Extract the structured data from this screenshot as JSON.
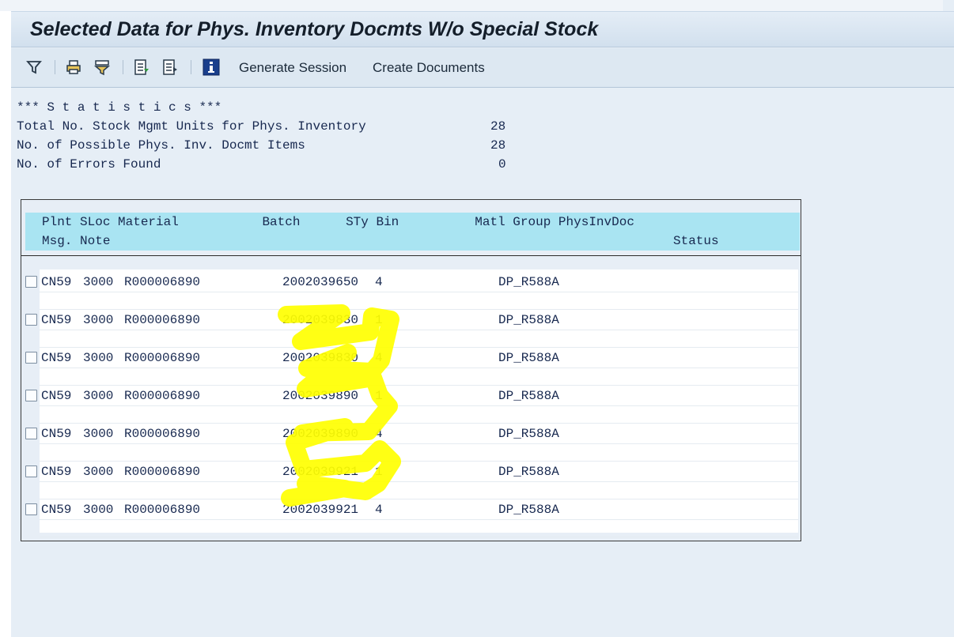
{
  "window": {
    "title": "Selected Data for Phys. Inventory Docmts W/o Special Stock"
  },
  "toolbar": {
    "icons": [
      "filter-icon",
      "print-icon",
      "print-filter-icon",
      "export-icon",
      "export-local-icon",
      "info-icon"
    ],
    "generate_session_label": "Generate Session",
    "create_documents_label": "Create Documents"
  },
  "statistics": {
    "heading": "*** S t a t i s t i c s ***",
    "lines": [
      {
        "label": "Total No. Stock Mgmt Units for Phys. Inventory",
        "value": "28"
      },
      {
        "label": "No. of Possible Phys. Inv. Docmt Items",
        "value": "28"
      },
      {
        "label": "No. of Errors Found",
        "value": "0"
      }
    ]
  },
  "table": {
    "header_line1": "Plnt SLoc Material           Batch      STy Bin          Matl Group PhysInvDoc",
    "header_line2": "Msg. Note",
    "header_status": "Status",
    "rows": [
      {
        "plant": "CN59",
        "sloc": "3000",
        "material": "R000006890",
        "batch": "2002039650",
        "sty": "4",
        "matl_group": "DP_R588A"
      },
      {
        "plant": "CN59",
        "sloc": "3000",
        "material": "R000006890",
        "batch": "2002039830",
        "sty": "1",
        "matl_group": "DP_R588A"
      },
      {
        "plant": "CN59",
        "sloc": "3000",
        "material": "R000006890",
        "batch": "2002039830",
        "sty": "4",
        "matl_group": "DP_R588A"
      },
      {
        "plant": "CN59",
        "sloc": "3000",
        "material": "R000006890",
        "batch": "2002039890",
        "sty": "1",
        "matl_group": "DP_R588A"
      },
      {
        "plant": "CN59",
        "sloc": "3000",
        "material": "R000006890",
        "batch": "2002039890",
        "sty": "4",
        "matl_group": "DP_R588A"
      },
      {
        "plant": "CN59",
        "sloc": "3000",
        "material": "R000006890",
        "batch": "2002039921",
        "sty": "1",
        "matl_group": "DP_R588A"
      },
      {
        "plant": "CN59",
        "sloc": "3000",
        "material": "R000006890",
        "batch": "2002039921",
        "sty": "4",
        "matl_group": "DP_R588A"
      }
    ]
  },
  "colors": {
    "text": "#17284f",
    "header_bg": "#a9e4f2",
    "highlight": "#ffff00",
    "screen_bg": "#e6eef6"
  }
}
